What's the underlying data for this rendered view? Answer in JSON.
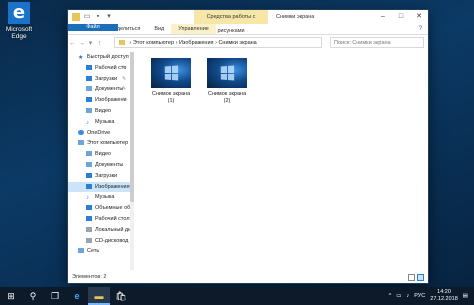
{
  "desktop": {
    "edge_icon_label": "Microsoft Edge"
  },
  "window": {
    "context_tab": "Средства работы с рисунками",
    "title": "Снимки экрана",
    "ribbon_tabs": [
      "Файл",
      "Главная",
      "Поделиться",
      "Вид",
      "Управление"
    ],
    "address": {
      "crumbs": [
        "Этот компьютер",
        "Изображения",
        "Снимки экрана"
      ]
    },
    "search_placeholder": "Поиск: Снимки экрана",
    "nav_items": [
      {
        "label": "Быстрый доступ",
        "icon": "star-icon",
        "level": 0,
        "pinned": false
      },
      {
        "label": "Рабочий сто",
        "icon": "folder-blue-icon",
        "level": 1,
        "pinned": true
      },
      {
        "label": "Загрузки",
        "icon": "download-icon",
        "level": 1,
        "pinned": true
      },
      {
        "label": "Документы",
        "icon": "documents-icon",
        "level": 1,
        "pinned": true
      },
      {
        "label": "Изображени",
        "icon": "pictures-icon",
        "level": 1,
        "pinned": true
      },
      {
        "label": "Видео",
        "icon": "video-icon",
        "level": 1,
        "pinned": false
      },
      {
        "label": "Музыка",
        "icon": "music-icon",
        "level": 1,
        "pinned": false
      },
      {
        "label": "OneDrive",
        "icon": "cloud-icon",
        "level": 0,
        "pinned": false
      },
      {
        "label": "Этот компьютер",
        "icon": "computer-icon",
        "level": 0,
        "pinned": false
      },
      {
        "label": "Видео",
        "icon": "video-icon",
        "level": 1,
        "pinned": false
      },
      {
        "label": "Документы",
        "icon": "documents-icon",
        "level": 1,
        "pinned": false
      },
      {
        "label": "Загрузки",
        "icon": "download-icon",
        "level": 1,
        "pinned": false
      },
      {
        "label": "Изображения",
        "icon": "pictures-icon",
        "level": 1,
        "pinned": false,
        "selected": true
      },
      {
        "label": "Музыка",
        "icon": "music-icon",
        "level": 1,
        "pinned": false
      },
      {
        "label": "Объемные объ",
        "icon": "objects-3d-icon",
        "level": 1,
        "pinned": false
      },
      {
        "label": "Рабочий стол",
        "icon": "folder-blue-icon",
        "level": 1,
        "pinned": false
      },
      {
        "label": "Локальный дис",
        "icon": "drive-icon",
        "level": 1,
        "pinned": false
      },
      {
        "label": "CD-дисковод (D",
        "icon": "cd-drive-icon",
        "level": 1,
        "pinned": false
      },
      {
        "label": "Сеть",
        "icon": "network-icon",
        "level": 0,
        "pinned": false
      }
    ],
    "files": [
      {
        "line1": "Снимок экрана",
        "line2": "(1)"
      },
      {
        "line1": "Снимок экрана",
        "line2": "(2)"
      }
    ],
    "status": "Элементов: 2"
  },
  "taskbar": {
    "lang": "РУС",
    "time": "14:20",
    "date": "27.12.2018"
  }
}
